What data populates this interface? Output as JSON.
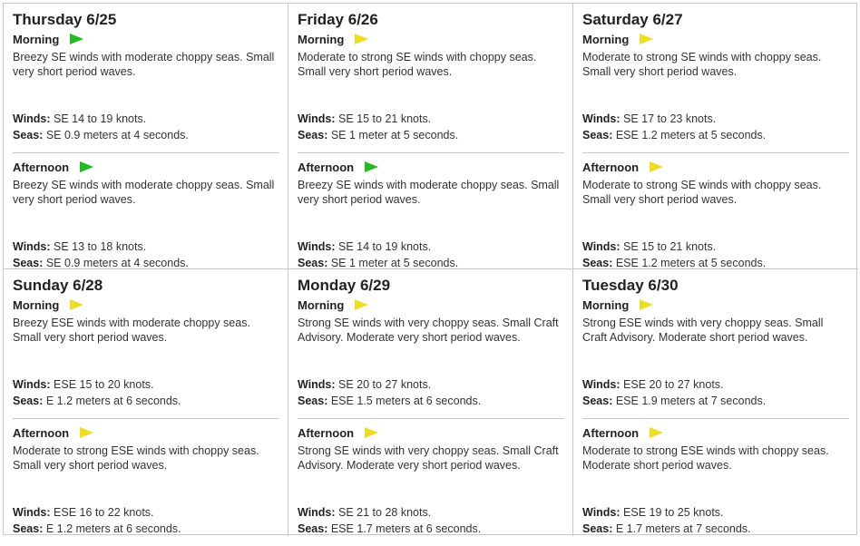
{
  "labels": {
    "morning": "Morning",
    "afternoon": "Afternoon",
    "winds": "Winds:",
    "seas": "Seas:"
  },
  "flag_colors": {
    "green": "#22bb22",
    "yellow": "#eedd22"
  },
  "days": [
    {
      "title": "Thursday 6/25",
      "morning": {
        "flag": "green",
        "summary": "Breezy SE winds with moderate choppy seas. Small very short period waves.",
        "winds": "SE 14 to 19 knots.",
        "seas": "SE 0.9 meters at 4 seconds."
      },
      "afternoon": {
        "flag": "green",
        "summary": "Breezy SE winds with moderate choppy seas. Small very short period waves.",
        "winds": "SE 13 to 18 knots.",
        "seas": "SE 0.9 meters at 4 seconds."
      }
    },
    {
      "title": "Friday 6/26",
      "morning": {
        "flag": "yellow",
        "summary": "Moderate to strong SE winds with choppy seas. Small very short period waves.",
        "winds": "SE 15 to 21 knots.",
        "seas": "SE 1 meter at 5 seconds."
      },
      "afternoon": {
        "flag": "green",
        "summary": "Breezy SE winds with moderate choppy seas. Small very short period waves.",
        "winds": "SE 14 to 19 knots.",
        "seas": "SE 1 meter at 5 seconds."
      }
    },
    {
      "title": "Saturday 6/27",
      "morning": {
        "flag": "yellow",
        "summary": "Moderate to strong SE winds with choppy seas. Small very short period waves.",
        "winds": "SE 17 to 23 knots.",
        "seas": "ESE 1.2 meters at 5 seconds."
      },
      "afternoon": {
        "flag": "yellow",
        "summary": "Moderate to strong SE winds with choppy seas. Small very short period waves.",
        "winds": "SE 15 to 21 knots.",
        "seas": "ESE 1.2 meters at 5 seconds."
      }
    },
    {
      "title": "Sunday 6/28",
      "morning": {
        "flag": "yellow",
        "summary": "Breezy ESE winds with moderate choppy seas. Small very short period waves.",
        "winds": "ESE 15 to 20 knots.",
        "seas": "E 1.2 meters at 6 seconds."
      },
      "afternoon": {
        "flag": "yellow",
        "summary": "Moderate to strong ESE winds with choppy seas. Small very short period waves.",
        "winds": "ESE 16 to 22 knots.",
        "seas": "E 1.2 meters at 6 seconds."
      }
    },
    {
      "title": "Monday 6/29",
      "morning": {
        "flag": "yellow",
        "summary": "Strong SE winds with very choppy seas. Small Craft Advisory. Moderate very short period waves.",
        "winds": "SE 20 to 27 knots.",
        "seas": "ESE 1.5 meters at 6 seconds."
      },
      "afternoon": {
        "flag": "yellow",
        "summary": "Strong SE winds with very choppy seas. Small Craft Advisory. Moderate very short period waves.",
        "winds": "SE 21 to 28 knots.",
        "seas": "ESE 1.7 meters at 6 seconds."
      }
    },
    {
      "title": "Tuesday 6/30",
      "morning": {
        "flag": "yellow",
        "summary": "Strong ESE winds with very choppy seas. Small Craft Advisory. Moderate short period waves.",
        "winds": "ESE 20 to 27 knots.",
        "seas": "ESE 1.9 meters at 7 seconds."
      },
      "afternoon": {
        "flag": "yellow",
        "summary": "Moderate to strong ESE winds with choppy seas. Moderate short period waves.",
        "winds": "ESE 19 to 25 knots.",
        "seas": "E 1.7 meters at 7 seconds."
      }
    }
  ]
}
